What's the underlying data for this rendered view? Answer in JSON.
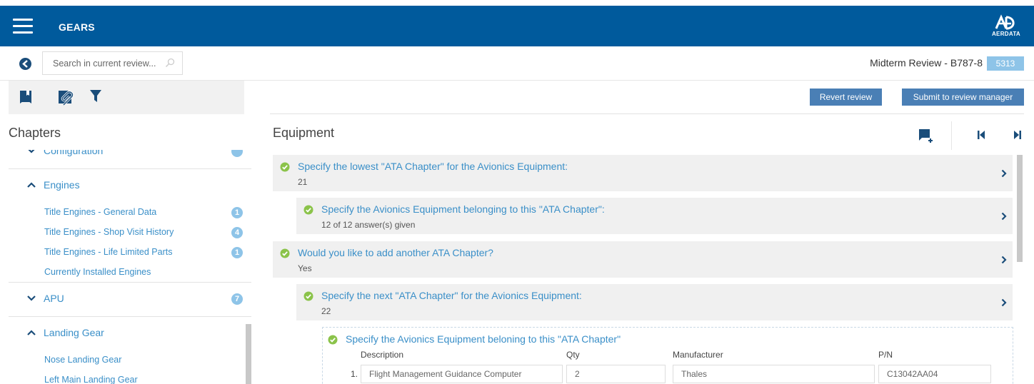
{
  "app": {
    "title": "GEARS",
    "logo_text": "AERDATA"
  },
  "subbar": {
    "search_placeholder": "Search in current review...",
    "review_title": "Midterm Review - B787-8",
    "review_id": "5313"
  },
  "actions": {
    "revert_label": "Revert review",
    "submit_label": "Submit to review manager"
  },
  "sidebar": {
    "title": "Chapters",
    "sections": [
      {
        "label": "Configuration",
        "expanded": false
      },
      {
        "label": "Engines",
        "expanded": true,
        "items": [
          {
            "label": "Title Engines - General Data",
            "count": "1"
          },
          {
            "label": "Title Engines - Shop Visit History",
            "count": "4"
          },
          {
            "label": "Title Engines - Life Limited Parts",
            "count": "1"
          },
          {
            "label": "Currently Installed Engines",
            "count": ""
          }
        ]
      },
      {
        "label": "APU",
        "expanded": false,
        "count": "7"
      },
      {
        "label": "Landing Gear",
        "expanded": true,
        "items": [
          {
            "label": "Nose Landing Gear"
          },
          {
            "label": "Left Main Landing Gear"
          }
        ]
      }
    ]
  },
  "main": {
    "title": "Equipment",
    "questions": [
      {
        "text": "Specify the lowest \"ATA Chapter\" for the Avionics Equipment:",
        "answer": "21"
      },
      {
        "text": "Specify the Avionics Equipment belonging to this \"ATA Chapter\":",
        "answer": "12 of 12 answer(s) given"
      },
      {
        "text": "Would you like to add another ATA Chapter?",
        "answer": "Yes"
      },
      {
        "text": "Specify the next \"ATA Chapter\" for the Avionics Equipment:",
        "answer": "22"
      }
    ],
    "detail": {
      "title": "Specify the Avionics Equipment beloning to this \"ATA Chapter\"",
      "columns": [
        "Description",
        "Qty",
        "Manufacturer",
        "P/N"
      ],
      "rows": [
        {
          "num": "1.",
          "description": "Flight Management Guidance Computer",
          "qty": "2",
          "manufacturer": "Thales",
          "pn": "C13042AA04"
        }
      ]
    }
  },
  "colors": {
    "header_bg": "#005a9c",
    "link": "#3a8fc8",
    "badge": "#8ec4e8",
    "button": "#4a7fb5",
    "check": "#8bc34a"
  }
}
